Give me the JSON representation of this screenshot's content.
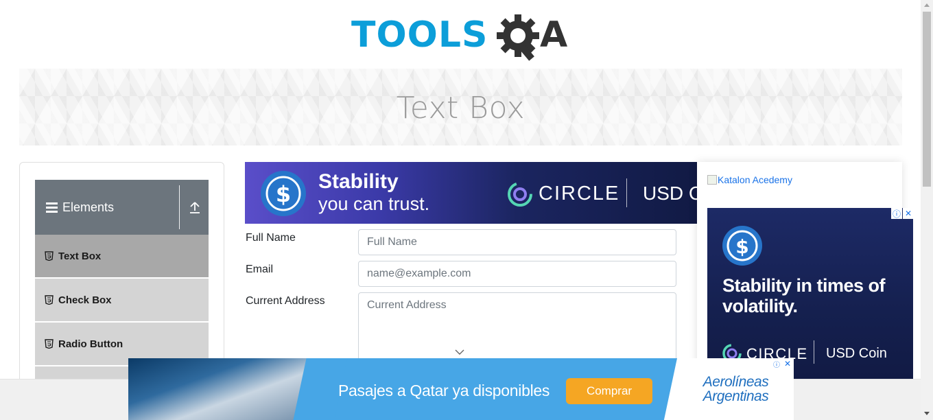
{
  "header": {
    "logo_text_blue": "TOOLS",
    "logo_text_dark": "QA"
  },
  "banner": {
    "title": "Text Box"
  },
  "sidebar": {
    "group_title": "Elements",
    "items": [
      {
        "label": "Text Box",
        "active": true
      },
      {
        "label": "Check Box",
        "active": false
      },
      {
        "label": "Radio Button",
        "active": false
      }
    ]
  },
  "form": {
    "full_name": {
      "label": "Full Name",
      "placeholder": "Full Name",
      "value": ""
    },
    "email": {
      "label": "Email",
      "placeholder": "name@example.com",
      "value": ""
    },
    "current_address": {
      "label": "Current Address",
      "placeholder": "Current Address",
      "value": ""
    }
  },
  "center_ad": {
    "headline": "Stability",
    "subline": "you can trust.",
    "brand": "CIRCLE",
    "product": "USD Coin"
  },
  "right_column": {
    "image_alt": "Katalon Acedemy",
    "ad": {
      "headline": "Stability in times of volatility.",
      "brand": "CIRCLE",
      "product": "USD Coin"
    }
  },
  "bottom_ad": {
    "message": "Pasajes a Qatar ya disponibles",
    "cta": "Comprar",
    "brand_line1": "Aerolíneas",
    "brand_line2": "Argentinas"
  },
  "colors": {
    "logo_blue": "#0c9ed9",
    "logo_dark": "#333333",
    "sidebar_header": "#6c757d",
    "menu_item": "#d4d4d4",
    "menu_item_active": "#a8a8a8",
    "banner_title": "#9a9a9a",
    "circle_ad_bg": "#1d2a66",
    "airline_blue": "#47a6e6",
    "cta_orange": "#f5a623"
  }
}
